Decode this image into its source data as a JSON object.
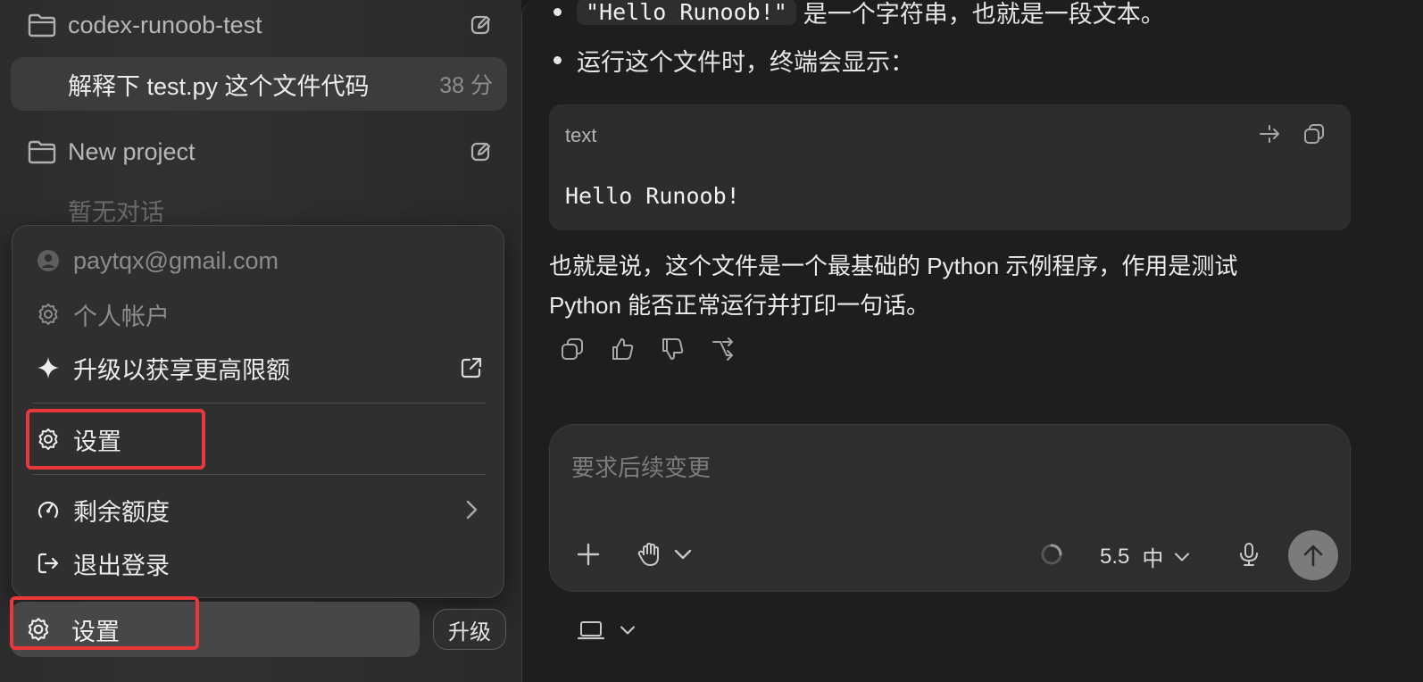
{
  "sidebar": {
    "projects": [
      {
        "name": "codex-runoob-test",
        "icon": "folder-icon"
      },
      {
        "name": "New project",
        "icon": "folder-icon"
      }
    ],
    "conversation": {
      "title": "解释下 test.py 这个文件代码",
      "time": "38 分"
    },
    "empty_note": "暂无对话"
  },
  "menu": {
    "email": "paytqx@gmail.com",
    "account": "个人帐户",
    "upgrade": "升级以获享更高限额",
    "settings": "设置",
    "quota": "剩余额度",
    "logout": "退出登录"
  },
  "bottom_bar": {
    "settings": "设置",
    "upgrade": "升级"
  },
  "main": {
    "bullet1_code": "\"Hello Runoob!\"",
    "bullet1_text": "是一个字符串，也就是一段文本。",
    "bullet2_text": "运行这个文件时，终端会显示：",
    "code_lang": "text",
    "code_content": "Hello Runoob!",
    "paragraph_1": "也就是说，这个文件是一个最基础的 Python 示例程序，作用是测试",
    "paragraph_2": "Python 能否正常运行并打印一句话。"
  },
  "composer": {
    "placeholder": "要求后续变更",
    "model": "5.5",
    "effort": "中"
  },
  "colors": {
    "highlight": "#e8383c",
    "send_button": "#7b7b7b"
  }
}
